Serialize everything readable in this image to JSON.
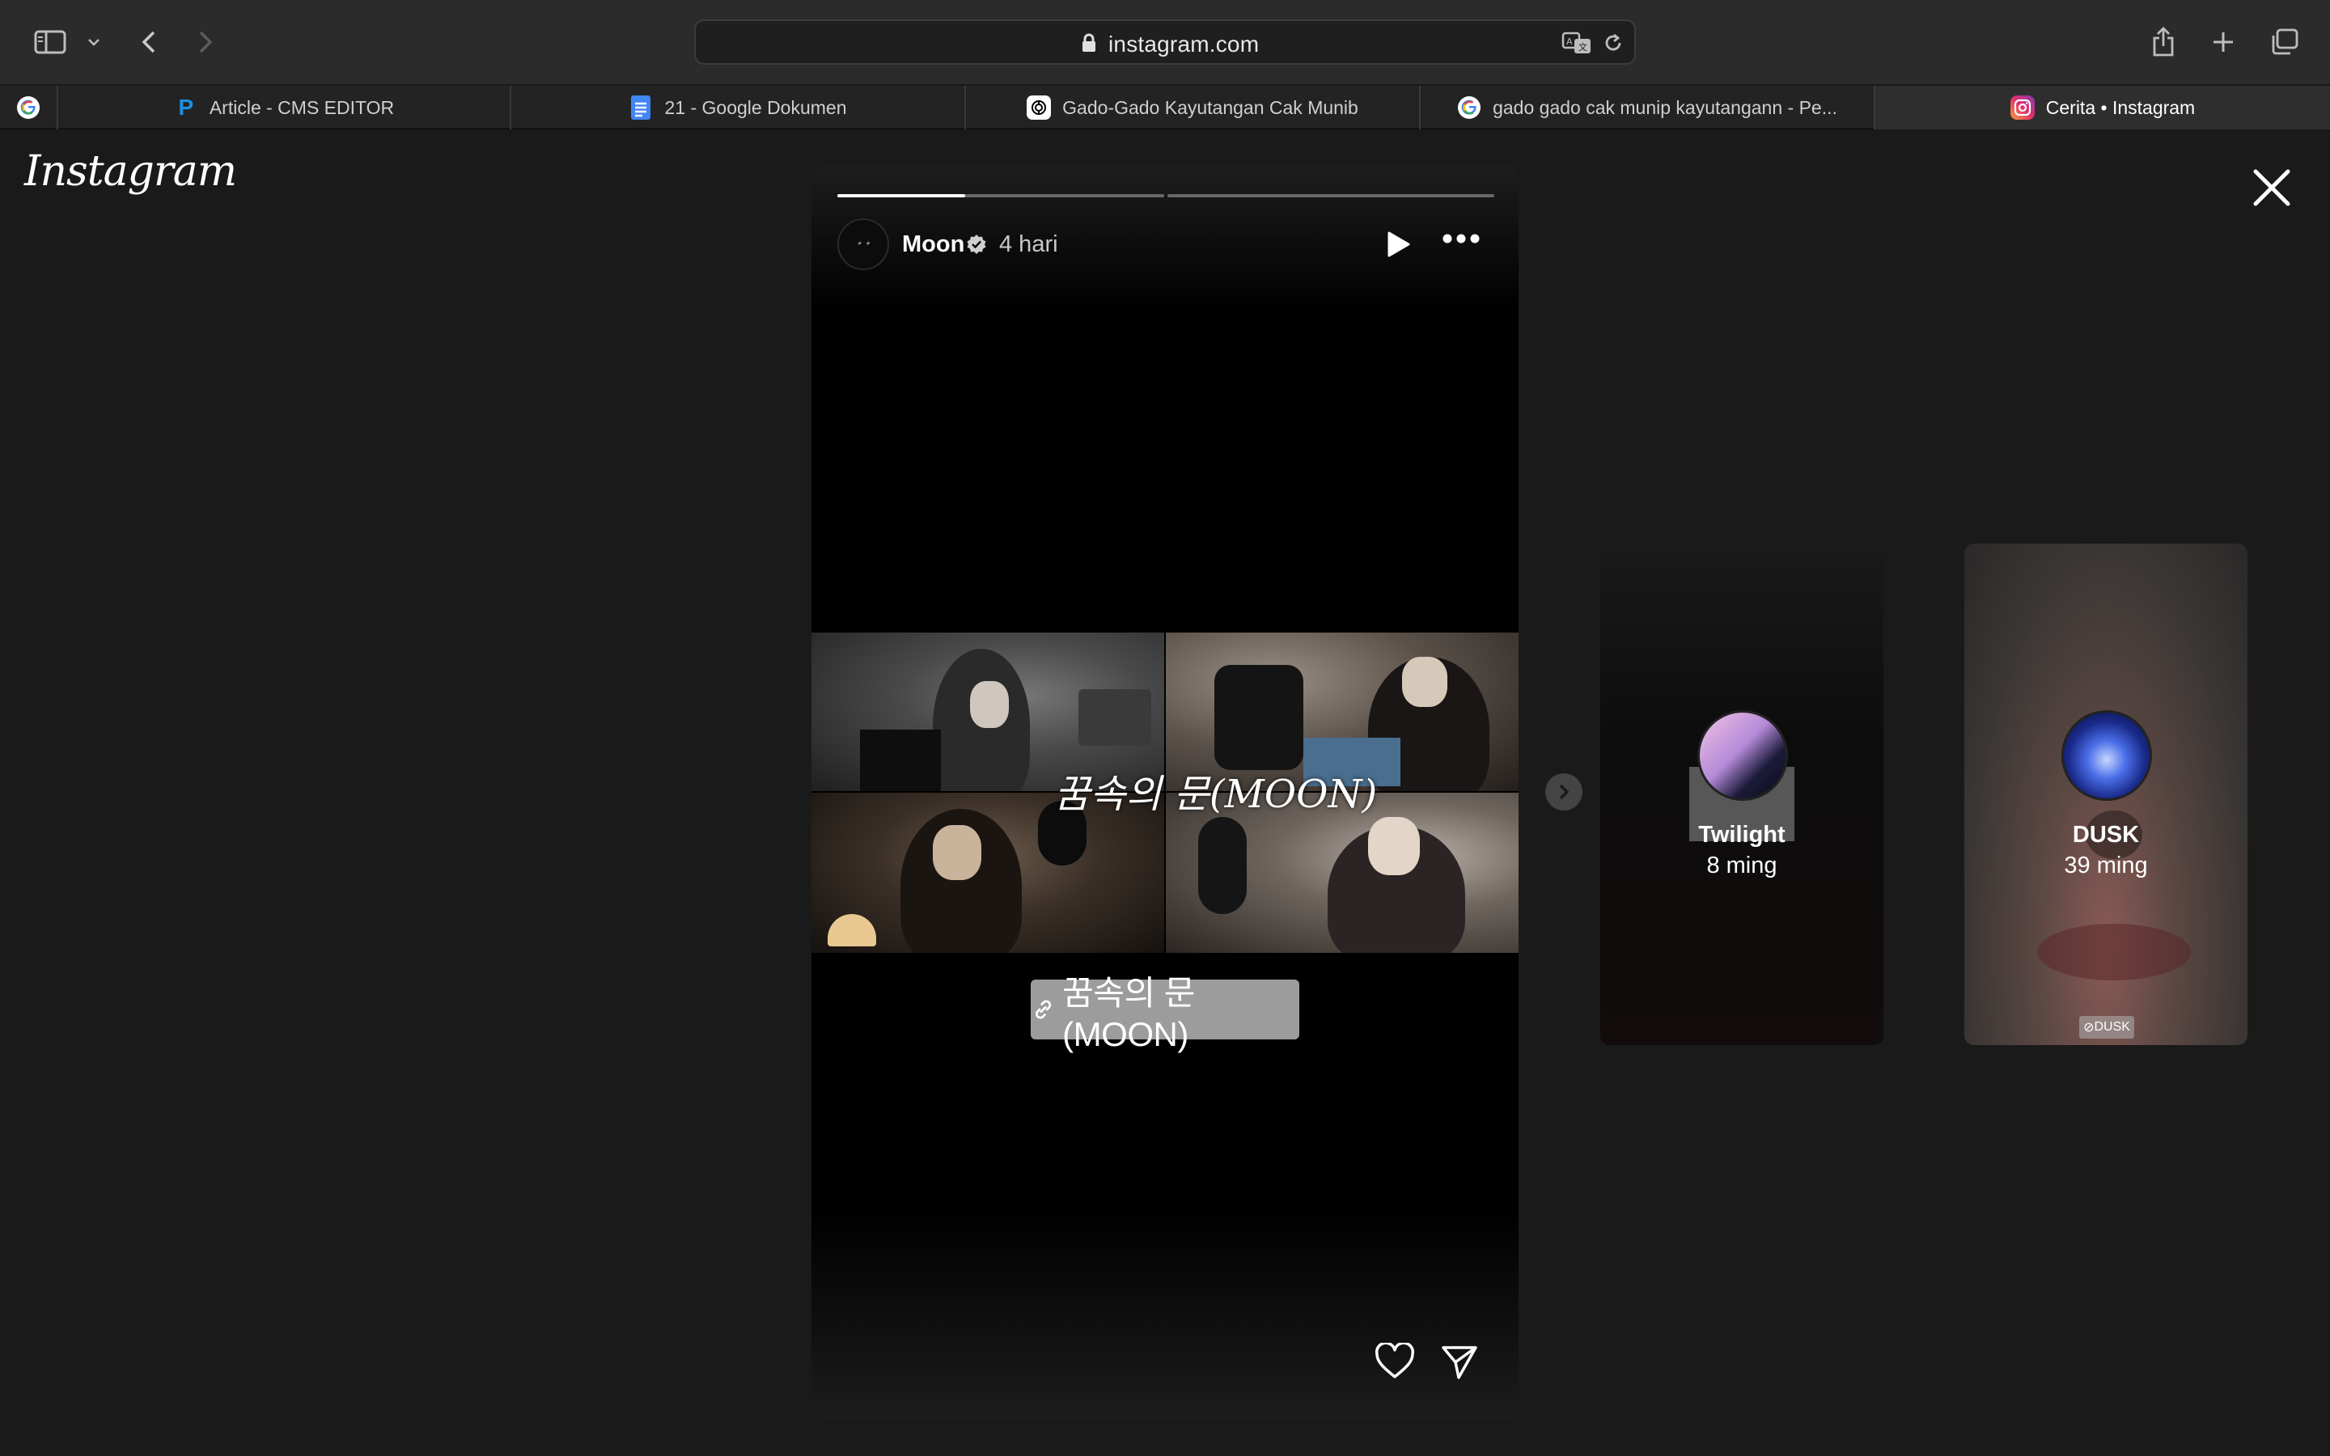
{
  "browser": {
    "url": "instagram.com",
    "tabs": [
      {
        "label": "",
        "icon": "google-icon"
      },
      {
        "label": "Article - CMS EDITOR",
        "icon": "cms-icon"
      },
      {
        "label": "21 - Google Dokumen",
        "icon": "google-docs-icon"
      },
      {
        "label": "Gado-Gado Kayutangan Cak Munib",
        "icon": "chatgpt-icon"
      },
      {
        "label": "gado gado cak munip kayutangann - Pe...",
        "icon": "google-icon"
      },
      {
        "label": "Cerita • Instagram",
        "icon": "instagram-icon",
        "active": true
      }
    ]
  },
  "instagram": {
    "logo": "Instagram"
  },
  "story": {
    "username": "Moon",
    "time": "4 hari",
    "progress": [
      0.39,
      0.0
    ],
    "collage_title": "꿈속의 문(MOON)",
    "link_sticker": "꿈속의 문(MOON)"
  },
  "previews": [
    {
      "name": "Twilight",
      "time": "8 ming"
    },
    {
      "name": "DUSK",
      "time": "39 ming",
      "tag": "DUSK"
    }
  ],
  "colors": {
    "page_bg": "#1a1a1a",
    "story_bg": "#000000",
    "chrome_bg": "#2b2b2b"
  }
}
